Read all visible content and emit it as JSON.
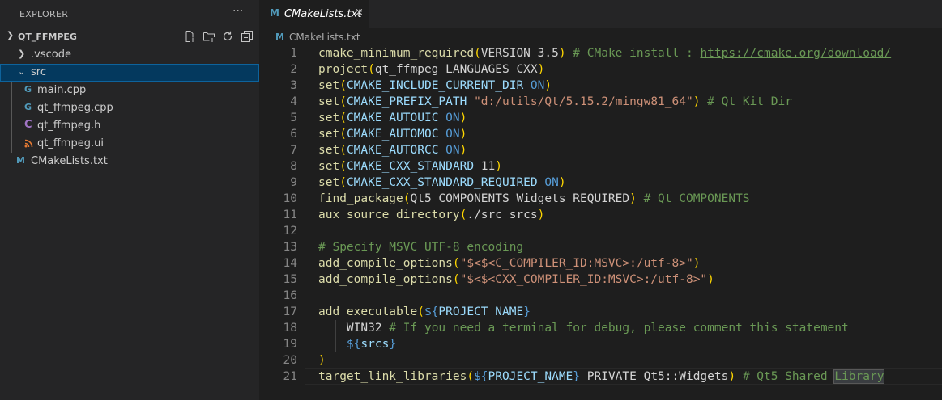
{
  "sidebar": {
    "title": "EXPLORER",
    "more": "···",
    "project": "QT_FFMPEG",
    "tree": [
      {
        "label": ".vscode",
        "type": "folder",
        "expanded": false
      },
      {
        "label": "src",
        "type": "folder",
        "expanded": true,
        "selected": true
      },
      {
        "label": "main.cpp",
        "type": "cpp",
        "icon": "G"
      },
      {
        "label": "qt_ffmpeg.cpp",
        "type": "cpp",
        "icon": "G"
      },
      {
        "label": "qt_ffmpeg.h",
        "type": "header",
        "icon": "C"
      },
      {
        "label": "qt_ffmpeg.ui",
        "type": "ui",
        "icon": "rss"
      },
      {
        "label": "CMakeLists.txt",
        "type": "cmake",
        "icon": "M"
      }
    ]
  },
  "editor": {
    "tab": {
      "icon": "M",
      "label": "CMakeLists.txt",
      "close": "×"
    },
    "breadcrumb": {
      "icon": "M",
      "label": "CMakeLists.txt"
    },
    "lines": [
      [
        [
          "fn",
          "cmake_minimum_required"
        ],
        [
          "b1",
          "("
        ],
        [
          "",
          "VERSION 3.5"
        ],
        [
          "b1",
          ")"
        ],
        [
          "",
          " "
        ],
        [
          "cm",
          "# CMake install : "
        ],
        [
          "link",
          "https://cmake.org/download/"
        ]
      ],
      [
        [
          "fn",
          "project"
        ],
        [
          "b1",
          "("
        ],
        [
          "",
          "qt_ffmpeg LANGUAGES CXX"
        ],
        [
          "b1",
          ")"
        ]
      ],
      [
        [
          "fn",
          "set"
        ],
        [
          "b1",
          "("
        ],
        [
          "var",
          "CMAKE_INCLUDE_CURRENT_DIR"
        ],
        [
          "",
          " "
        ],
        [
          "kw",
          "ON"
        ],
        [
          "b1",
          ")"
        ]
      ],
      [
        [
          "fn",
          "set"
        ],
        [
          "b1",
          "("
        ],
        [
          "var",
          "CMAKE_PREFIX_PATH"
        ],
        [
          "",
          " "
        ],
        [
          "str",
          "\"d:/utils/Qt/5.15.2/mingw81_64\""
        ],
        [
          "b1",
          ")"
        ],
        [
          "",
          " "
        ],
        [
          "cm",
          "# Qt Kit Dir"
        ]
      ],
      [
        [
          "fn",
          "set"
        ],
        [
          "b1",
          "("
        ],
        [
          "var",
          "CMAKE_AUTOUIC"
        ],
        [
          "",
          " "
        ],
        [
          "kw",
          "ON"
        ],
        [
          "b1",
          ")"
        ]
      ],
      [
        [
          "fn",
          "set"
        ],
        [
          "b1",
          "("
        ],
        [
          "var",
          "CMAKE_AUTOMOC"
        ],
        [
          "",
          " "
        ],
        [
          "kw",
          "ON"
        ],
        [
          "b1",
          ")"
        ]
      ],
      [
        [
          "fn",
          "set"
        ],
        [
          "b1",
          "("
        ],
        [
          "var",
          "CMAKE_AUTORCC"
        ],
        [
          "",
          " "
        ],
        [
          "kw",
          "ON"
        ],
        [
          "b1",
          ")"
        ]
      ],
      [
        [
          "fn",
          "set"
        ],
        [
          "b1",
          "("
        ],
        [
          "var",
          "CMAKE_CXX_STANDARD"
        ],
        [
          "",
          " 11"
        ],
        [
          "b1",
          ")"
        ]
      ],
      [
        [
          "fn",
          "set"
        ],
        [
          "b1",
          "("
        ],
        [
          "var",
          "CMAKE_CXX_STANDARD_REQUIRED"
        ],
        [
          "",
          " "
        ],
        [
          "kw",
          "ON"
        ],
        [
          "b1",
          ")"
        ]
      ],
      [
        [
          "fn",
          "find_package"
        ],
        [
          "b1",
          "("
        ],
        [
          "",
          "Qt5 COMPONENTS Widgets REQUIRED"
        ],
        [
          "b1",
          ")"
        ],
        [
          "",
          " "
        ],
        [
          "cm",
          "# Qt COMPONENTS"
        ]
      ],
      [
        [
          "fn",
          "aux_source_directory"
        ],
        [
          "b1",
          "("
        ],
        [
          "",
          "./src srcs"
        ],
        [
          "b1",
          ")"
        ]
      ],
      [],
      [
        [
          "cm",
          "# Specify MSVC UTF-8 encoding"
        ]
      ],
      [
        [
          "fn",
          "add_compile_options"
        ],
        [
          "b1",
          "("
        ],
        [
          "str",
          "\"$<$<C_COMPILER_ID:MSVC>:/utf-8>\""
        ],
        [
          "b1",
          ")"
        ]
      ],
      [
        [
          "fn",
          "add_compile_options"
        ],
        [
          "b1",
          "("
        ],
        [
          "str",
          "\"$<$<CXX_COMPILER_ID:MSVC>:/utf-8>\""
        ],
        [
          "b1",
          ")"
        ]
      ],
      [],
      [
        [
          "fn",
          "add_executable"
        ],
        [
          "b1",
          "("
        ],
        [
          "kw",
          "${"
        ],
        [
          "var",
          "PROJECT_NAME"
        ],
        [
          "kw",
          "}"
        ]
      ],
      [
        [
          "",
          "    WIN32 "
        ],
        [
          "cm",
          "# If you need a terminal for debug, please comment this statement"
        ]
      ],
      [
        [
          "",
          "    "
        ],
        [
          "kw",
          "${"
        ],
        [
          "var",
          "srcs"
        ],
        [
          "kw",
          "}"
        ]
      ],
      [
        [
          "b1",
          ")"
        ]
      ],
      [
        [
          "fn",
          "target_link_libraries"
        ],
        [
          "b1",
          "("
        ],
        [
          "kw",
          "${"
        ],
        [
          "var",
          "PROJECT_NAME"
        ],
        [
          "kw",
          "}"
        ],
        [
          "",
          " PRIVATE Qt5::Widgets"
        ],
        [
          "b1",
          ")"
        ],
        [
          "",
          " "
        ],
        [
          "cm",
          "# Qt5 Shared "
        ],
        [
          "cmhl",
          "Library"
        ]
      ]
    ]
  }
}
